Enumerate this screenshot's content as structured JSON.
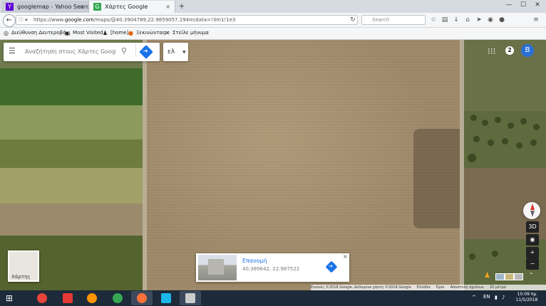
{
  "browser": {
    "tabs": [
      {
        "favicon": "Y",
        "title": "googlemap - Yahoo Searc...",
        "close": "×"
      },
      {
        "favicon": "G",
        "title": "Χάρτες Google",
        "close": "×"
      }
    ],
    "new_tab": "+",
    "window_controls": [
      "—",
      "☐",
      "✕"
    ],
    "url_scheme": "https://www.",
    "url_domain": "google.com",
    "url_rest": "/maps/@40.3904789,22.9859057,194m/data=!3m1!1e3",
    "search_placeholder": "Search",
    "bookmarks": [
      {
        "icon": "globe-icon",
        "label": "Διεύθυνση Δευτεροβά..."
      },
      {
        "icon": "folder-icon",
        "label": "Most Visited"
      },
      {
        "icon": "person-icon",
        "label": "[home]"
      },
      {
        "icon": "firefox-icon",
        "label": "Ξεκινώντας"
      },
      {
        "icon": "mail-icon",
        "label": "Στείλε μήνυμα"
      }
    ]
  },
  "maps": {
    "search_placeholder": "Αναζήτηση στους Χάρτες Google",
    "language": "ελ",
    "notifications": "2",
    "avatar_letter": "B",
    "controls": {
      "tilt": "3D",
      "zoom_in": "+",
      "zoom_out": "−"
    },
    "layers_label": "Χάρτης",
    "place": {
      "name": "Επανομή",
      "coords": "40.389642, 22.987522",
      "close": "×"
    },
    "attribution": [
      "Εικόνες ©2018 Google, Δεδομένα χάρτη ©2018 Google",
      "Ελλάδα",
      "Όροι",
      "Αποστολή σχολίων",
      "20 μέτρα"
    ]
  },
  "taskbar": {
    "language": "EN",
    "time": "10:09 πμ",
    "date": "11/5/2018",
    "apps": [
      {
        "name": "chrome-taskbar-icon",
        "color": "#e8453c"
      },
      {
        "name": "download-taskbar-icon",
        "color": "#e53935"
      },
      {
        "name": "firefox-taskbar-icon",
        "color": "#ff9500"
      },
      {
        "name": "chrome-taskbar-icon-2",
        "color": "#34a853"
      },
      {
        "name": "firefox-taskbar-icon-2",
        "color": "#ff7139"
      },
      {
        "name": "vimeo-taskbar-icon",
        "color": "#1ab7ea"
      },
      {
        "name": "paint-taskbar-icon",
        "color": "#cccccc"
      }
    ]
  }
}
